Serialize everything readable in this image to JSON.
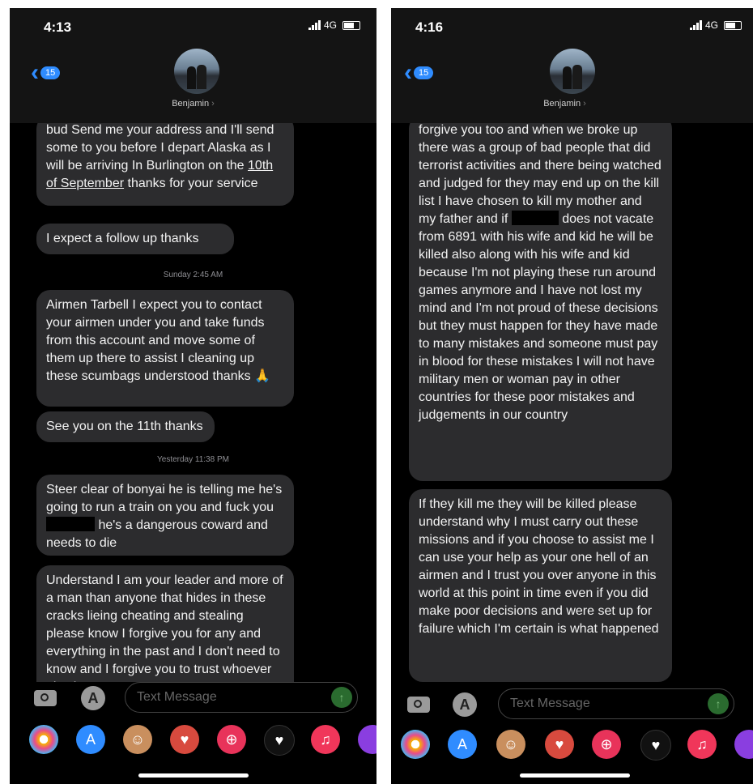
{
  "screens": [
    {
      "time": "4:13",
      "network": "4G",
      "back_count": "15",
      "contact_name": "Benjamin",
      "input_placeholder": "Text Message",
      "messages": [
        {
          "type": "bubble",
          "text": "bud Send me your address and I'll send some to you before I depart Alaska as I will be arriving In Burlington on the",
          "link": "10th of September",
          "text_after": "thanks for your service"
        },
        {
          "type": "bubble",
          "text": "I expect a follow up thanks"
        },
        {
          "type": "timestamp",
          "text": "Sunday 2:45 AM"
        },
        {
          "type": "bubble",
          "text": "Airmen Tarbell I expect you to contact your airmen under you and take funds from this account and move some of them up there to assist I cleaning up these scumbags understood thanks 🙏"
        },
        {
          "type": "bubble",
          "text": "See you on the 11th thanks"
        },
        {
          "type": "timestamp",
          "text": "Yesterday 11:38 PM"
        },
        {
          "type": "bubble",
          "text_before": "Steer clear of bonyai he is telling me he's going to run a train on you and fuck you",
          "text_after": "he's a dangerous coward and needs to die"
        },
        {
          "type": "bubble",
          "text": "Understand I am your leader and more of a man than anyone that hides in these cracks lieing cheating and stealing please know I forgive you for any and everything in the past and I don't need to know and I forgive you to trust whoever else but"
        }
      ]
    },
    {
      "time": "4:16",
      "network": "4G",
      "back_count": "15",
      "contact_name": "Benjamin",
      "input_placeholder": "Text Message",
      "messages": [
        {
          "type": "bubble",
          "text_before": "forgive you too and when we broke up there was a group of bad people that did terrorist activities and there being watched and judged for they may end up on the kill list I have chosen to kill my mother and my father and if",
          "text_after": "does not vacate from 6891 with his wife and kid he will be killed also along with his wife and kid because I'm not playing these run around games anymore and I have not lost my mind and I'm not proud of these decisions but they must happen for they have made to many mistakes and someone must pay in blood for these mistakes I will not have military men or woman pay in other countries for these poor mistakes and judgements in our country"
        },
        {
          "type": "bubble",
          "text": "If they kill me they will be killed please understand why I must carry out these missions and if you choose to assist me I can use your help as your one hell of an airmen and I trust you over anyone in this world at this point in time even if you did make poor decisions and were set up for failure which I'm certain is what happened"
        }
      ]
    }
  ],
  "dock_apps": [
    "photos-icon",
    "app-store-icon",
    "memoji-icon",
    "animoji-icon",
    "search-images-icon",
    "digital-touch-icon",
    "music-icon",
    "more-app-icon"
  ],
  "colors": {
    "bubble": "#2c2c2e",
    "accent": "#2f8cff",
    "background": "#000000"
  }
}
